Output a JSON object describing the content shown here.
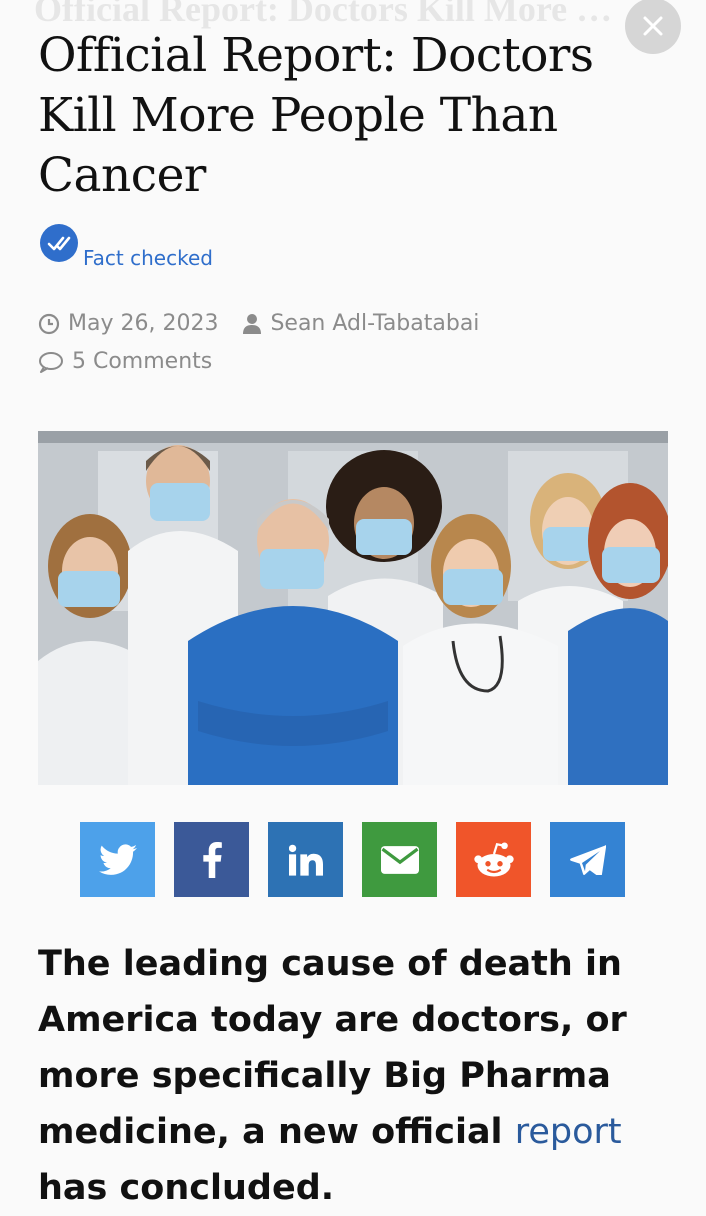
{
  "header": {
    "ghost_title": "Official Report: Doctors Kill More Pe...",
    "close_icon": "close-icon"
  },
  "article": {
    "title": "Official Report: Doctors Kill More People Than Cancer",
    "fact_check_label": "Fact checked",
    "date": "May 26, 2023",
    "author": "Sean Adl-Tabatabai",
    "comments": "5 Comments",
    "lead_before": "The leading cause of death in America today are doctors, or more specifically Big Pharma medicine, a new official ",
    "lead_link": "report",
    "lead_after": " has concluded."
  },
  "share": [
    {
      "name": "twitter",
      "icon": "twitter-icon",
      "color": "#4da1ea"
    },
    {
      "name": "facebook",
      "icon": "facebook-icon",
      "color": "#3b5998"
    },
    {
      "name": "linkedin",
      "icon": "linkedin-icon",
      "color": "#2d72b4"
    },
    {
      "name": "email",
      "icon": "email-icon",
      "color": "#3f9a3f"
    },
    {
      "name": "reddit",
      "icon": "reddit-icon",
      "color": "#f0552a"
    },
    {
      "name": "telegram",
      "icon": "telegram-icon",
      "color": "#3483d3"
    }
  ],
  "colors": {
    "link": "#2f6ecb",
    "meta": "#8b8b8b"
  }
}
